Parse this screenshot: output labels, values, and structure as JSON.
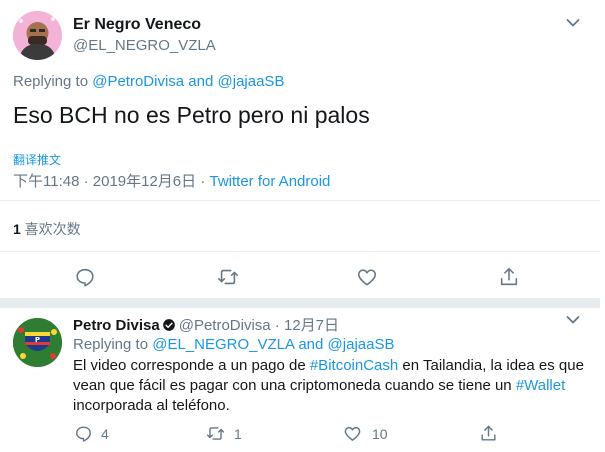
{
  "main_tweet": {
    "author_name": "Er Negro Veneco",
    "author_handle": "@EL_NEGRO_VZLA",
    "replying_prefix": "Replying to ",
    "replying_to_1": "@PetroDivisa",
    "replying_and": " and ",
    "replying_to_2": "@jajaaSB",
    "text": "Eso BCH no es Petro pero ni palos",
    "translate_label": "翻译推文",
    "timestamp": "下午11:48 · 2019年12月6日",
    "separator": " · ",
    "source": "Twitter for Android",
    "like_count": "1",
    "like_label": " 喜欢次数"
  },
  "reply_tweet": {
    "author_name": "Petro Divisa",
    "author_handle": "@PetroDivisa",
    "date": " · 12月7日",
    "replying_prefix": "Replying to ",
    "replying_to_1": "@EL_NEGRO_VZLA",
    "replying_and": " and ",
    "replying_to_2": "@jajaaSB",
    "text_part1": "El video corresponde a un pago de ",
    "hashtag_1": "#BitcoinCash",
    "text_part2": " en Tailandia, la idea es que vean que fácil es pagar con una criptomoneda cuando se tiene un ",
    "hashtag_2": "#Wallet",
    "text_part3": " incorporada al teléfono.",
    "reply_count": "4",
    "retweet_count": "1",
    "like_count": "10"
  },
  "colors": {
    "accent": "#1b95e0",
    "secondary_text": "#657786",
    "divider": "#e6ecf0"
  },
  "icons": [
    "chevron-down-icon",
    "reply-icon",
    "retweet-icon",
    "like-icon",
    "share-icon",
    "verified-badge-icon"
  ]
}
